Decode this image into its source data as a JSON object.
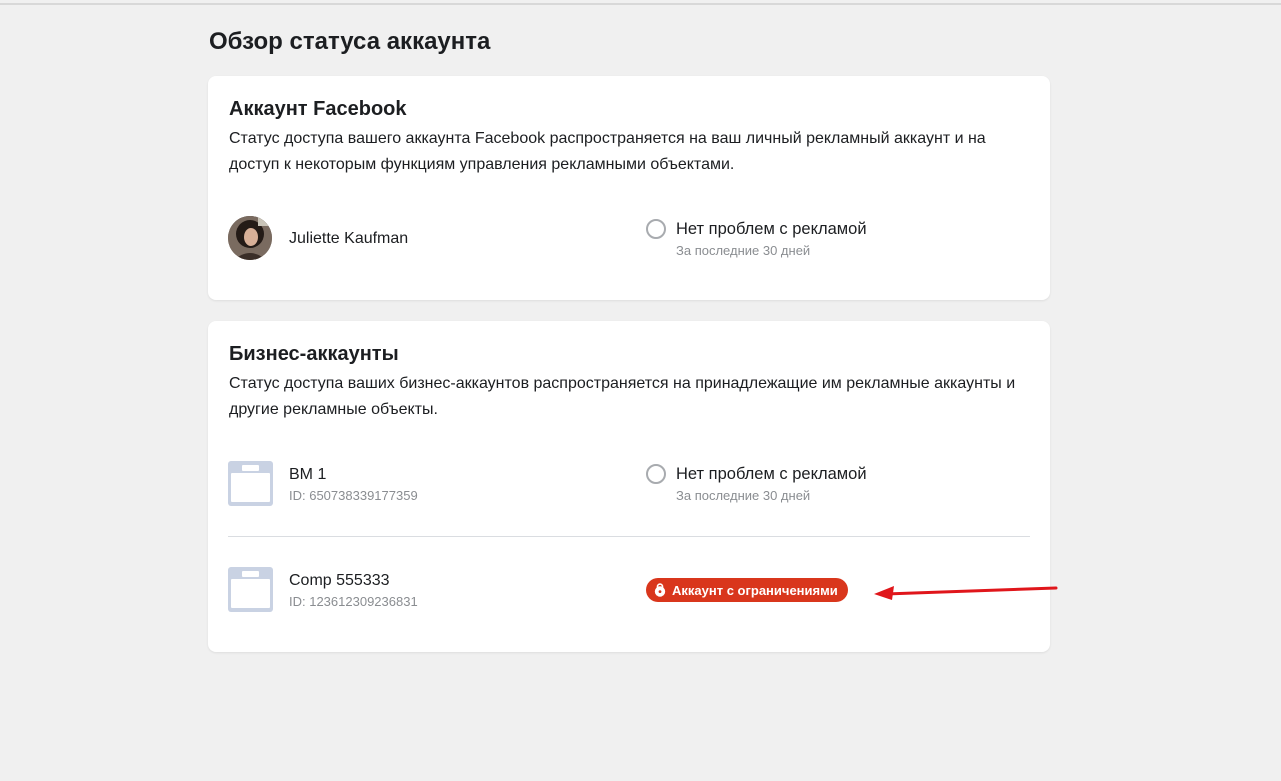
{
  "page": {
    "title": "Обзор статуса аккаунта"
  },
  "facebook_card": {
    "title": "Аккаунт Facebook",
    "description": "Статус доступа вашего аккаунта Facebook распространяется на ваш личный рекламный аккаунт и на доступ к некоторым функциям управления рекламными объектами.",
    "user": {
      "name": "Juliette Kaufman",
      "status": "Нет проблем с рекламой",
      "status_period": "За последние 30 дней"
    }
  },
  "business_card": {
    "title": "Бизнес-аккаунты",
    "description": "Статус доступа ваших бизнес-аккаунтов распространяется на принадлежащие им рекламные аккаунты и другие рекламные объекты.",
    "accounts": [
      {
        "name": "BM 1",
        "id": "ID: 650738339177359",
        "status": "Нет проблем с рекламой",
        "status_period": "За последние 30 дней"
      },
      {
        "name": "Comp 555333",
        "id": "ID: 123612309236831",
        "badge": "Аккаунт с ограничениями"
      }
    ]
  },
  "colors": {
    "background": "#f0f0f0",
    "card": "#ffffff",
    "restricted_badge": "#d9361c",
    "annotation_arrow": "#e0161b",
    "icon_tint": "#c9d2e3"
  },
  "icons": {
    "avatar": "user-avatar",
    "business": "briefcase-icon",
    "status": "empty-circle-icon",
    "restricted": "lock-icon",
    "annotation": "red-arrow"
  }
}
